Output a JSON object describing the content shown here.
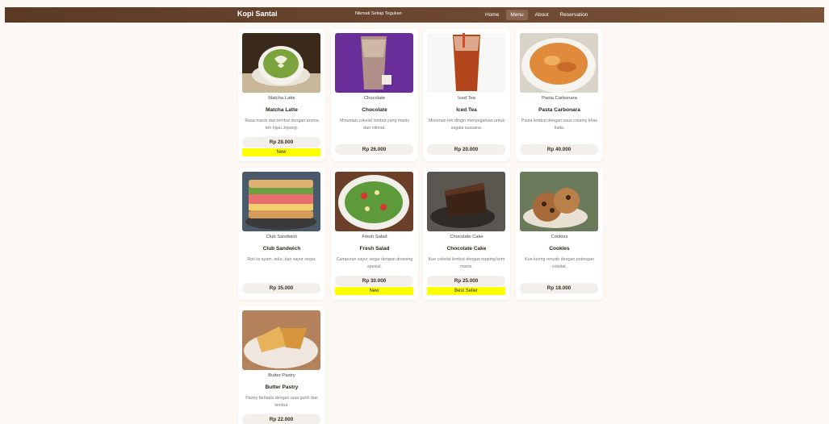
{
  "header": {
    "brand": "Kopi Santai",
    "tagline": "Nikmati Setiap Tegukan",
    "nav": [
      {
        "label": "Home"
      },
      {
        "label": "Menu"
      },
      {
        "label": "About"
      },
      {
        "label": "Reservation"
      }
    ]
  },
  "menu": [
    {
      "caption": "Matcha Latte",
      "name": "Matcha Latte",
      "desc": "Rasa manis dan lembut dengan aroma teh hijau Jepang.",
      "price": "Rp 28.000",
      "badge": "New"
    },
    {
      "caption": "Chocolate",
      "name": "Chocolate",
      "desc": "Minuman cokelat lembut yang manis dan nikmat.",
      "price": "Rp 26.000",
      "badge": ""
    },
    {
      "caption": "Iced Tea",
      "name": "Iced Tea",
      "desc": "Minuman teh dingin menyegarkan untuk segala suasana.",
      "price": "Rp 20.000",
      "badge": ""
    },
    {
      "caption": "Pasta Carbonara",
      "name": "Pasta Carbonara",
      "desc": "Pasta lembut dengan saus creamy khas Italia.",
      "price": "Rp 40.000",
      "badge": ""
    },
    {
      "caption": "Club Sandwich",
      "name": "Club Sandwich",
      "desc": "Roti isi ayam, telur, dan sayur segar.",
      "price": "Rp 35.000",
      "badge": ""
    },
    {
      "caption": "Fresh Salad",
      "name": "Fresh Salad",
      "desc": "Campuran sayur segar dengan dressing spesial.",
      "price": "Rp 30.000",
      "badge": "New"
    },
    {
      "caption": "Chocolate Cake",
      "name": "Chocolate Cake",
      "desc": "Kue cokelat lembut dengan topping krim manis.",
      "price": "Rp 25.000",
      "badge": "Best Seller"
    },
    {
      "caption": "Cookies",
      "name": "Cookies",
      "desc": "Kue kering renyah dengan potongan cokelat.",
      "price": "Rp 18.000",
      "badge": ""
    },
    {
      "caption": "Butter Pastry",
      "name": "Butter Pastry",
      "desc": "Pastry berlapis dengan rasa gurih dan lembut.",
      "price": "Rp 22.000",
      "badge": ""
    }
  ]
}
